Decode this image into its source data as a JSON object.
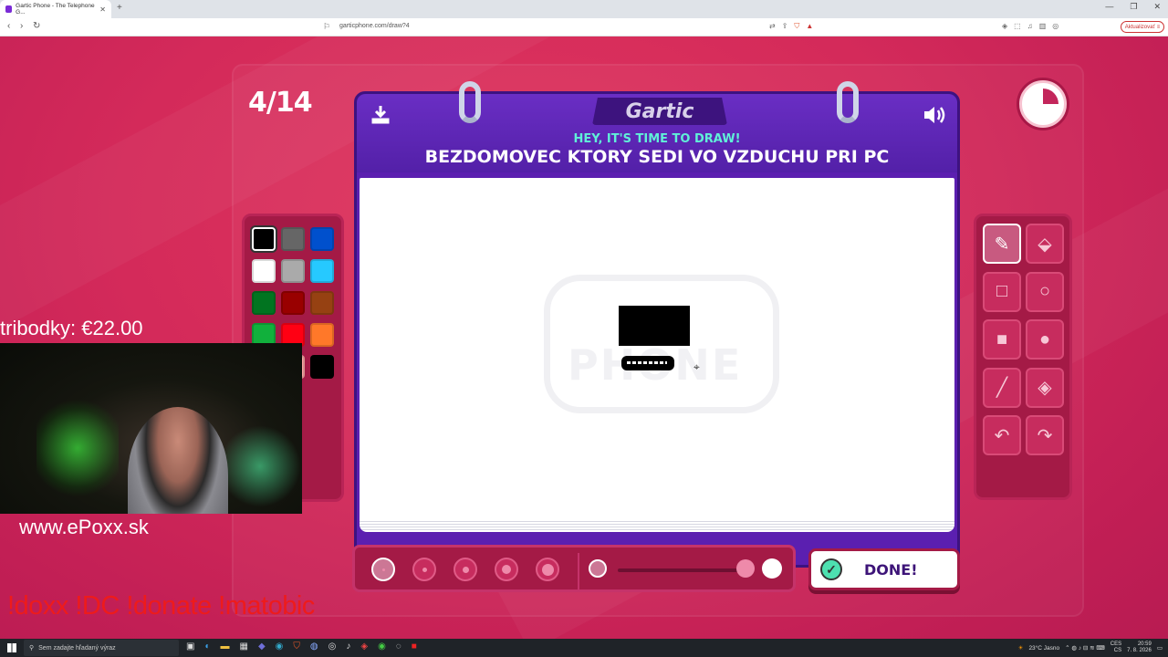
{
  "browser": {
    "tab_title": "Gartic Phone - The Telephone G...",
    "url": "garticphone.com/draw?4",
    "update_label": "Aktualizovať"
  },
  "game": {
    "round": "4/14",
    "logo": "Gartic",
    "subtitle": "HEY, IT'S TIME TO DRAW!",
    "prompt": "BEZDOMOVEC KTORY SEDI VO VZDUCHU PRI PC",
    "watermark": "PHONE",
    "done_label": "DONE!",
    "palette": [
      "#000000",
      "#666666",
      "#0050cd",
      "#ffffff",
      "#aaaaaa",
      "#26c9ff",
      "#017420",
      "#990000",
      "#964112",
      "#11b03c",
      "#ff0013",
      "#ff7829",
      "#c25058",
      "#ffa7a7",
      "#000000"
    ],
    "selected_color_index": 0,
    "tools": [
      "pencil-icon",
      "eraser-icon",
      "rectangle-outline-icon",
      "circle-outline-icon",
      "rectangle-fill-icon",
      "circle-fill-icon",
      "line-icon",
      "fill-bucket-icon",
      "undo-icon",
      "redo-icon"
    ],
    "active_tool": "pencil-icon",
    "brush_sizes": 5,
    "selected_brush_size_index": 0
  },
  "stream": {
    "donation_text": "tribodky: €22.00",
    "website": "www.ePoxx.sk",
    "commands": "!doxx  !DC !donate !matobic"
  },
  "taskbar": {
    "search_placeholder": "Sem zadajte hľadaný výraz",
    "weather": "23°C  Jasno",
    "lang": "CES",
    "lang2": "CS",
    "time": "20:59",
    "date": "7. 8. 2026"
  }
}
